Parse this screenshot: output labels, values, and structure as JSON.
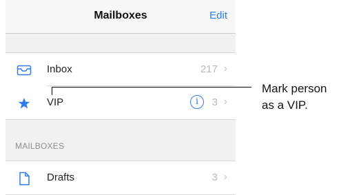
{
  "navbar": {
    "title": "Mailboxes",
    "edit_label": "Edit"
  },
  "mailboxes_top": [
    {
      "label": "Inbox",
      "count": "217",
      "icon": "inbox-icon"
    },
    {
      "label": "VIP",
      "count": "3",
      "icon": "star-icon"
    }
  ],
  "section_header": "MAILBOXES",
  "mailboxes_bottom": [
    {
      "label": "Drafts",
      "count": "3",
      "icon": "drafts-icon"
    }
  ],
  "callout": {
    "line1": "Mark person",
    "line2": "as a VIP."
  },
  "colors": {
    "accent": "#2f7cf6",
    "background": "#f1f1f4"
  }
}
